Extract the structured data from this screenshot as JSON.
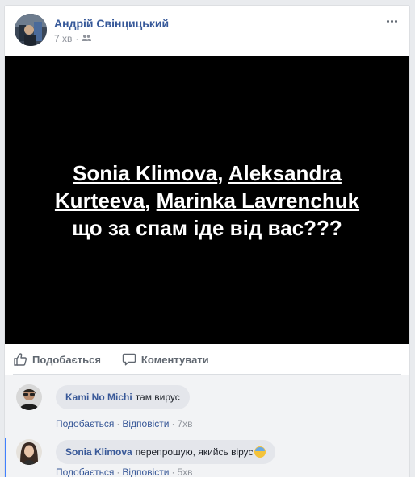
{
  "post": {
    "author": "Андрій Свінцицький",
    "time": "7 хв",
    "dot": "·",
    "image_text": {
      "mention_1": "Sonia Klimova",
      "comma_1": ", ",
      "mention_2": "Aleksandra Kurteeva",
      "comma_2": ", ",
      "mention_3": "Marinka Lavrenchuk",
      "tail": "що за спам іде від вас???"
    }
  },
  "actions": {
    "like": "Подобається",
    "comment": "Коментувати"
  },
  "comments": [
    {
      "author": "Kami No Michi",
      "text": "там вирус",
      "like": "Подобається",
      "reply": "Відповісти",
      "time": "7хв",
      "dot": "·"
    },
    {
      "author": "Sonia Klimova",
      "text": "перепрошую, якийсь вірус",
      "emoji": "fearful-face-emoji",
      "like": "Подобається",
      "reply": "Відповісти",
      "time": "5хв",
      "dot": "·"
    }
  ],
  "colors": {
    "link": "#365899",
    "image_bg": "#000000",
    "meta": "#90949c",
    "action": "#606770"
  }
}
